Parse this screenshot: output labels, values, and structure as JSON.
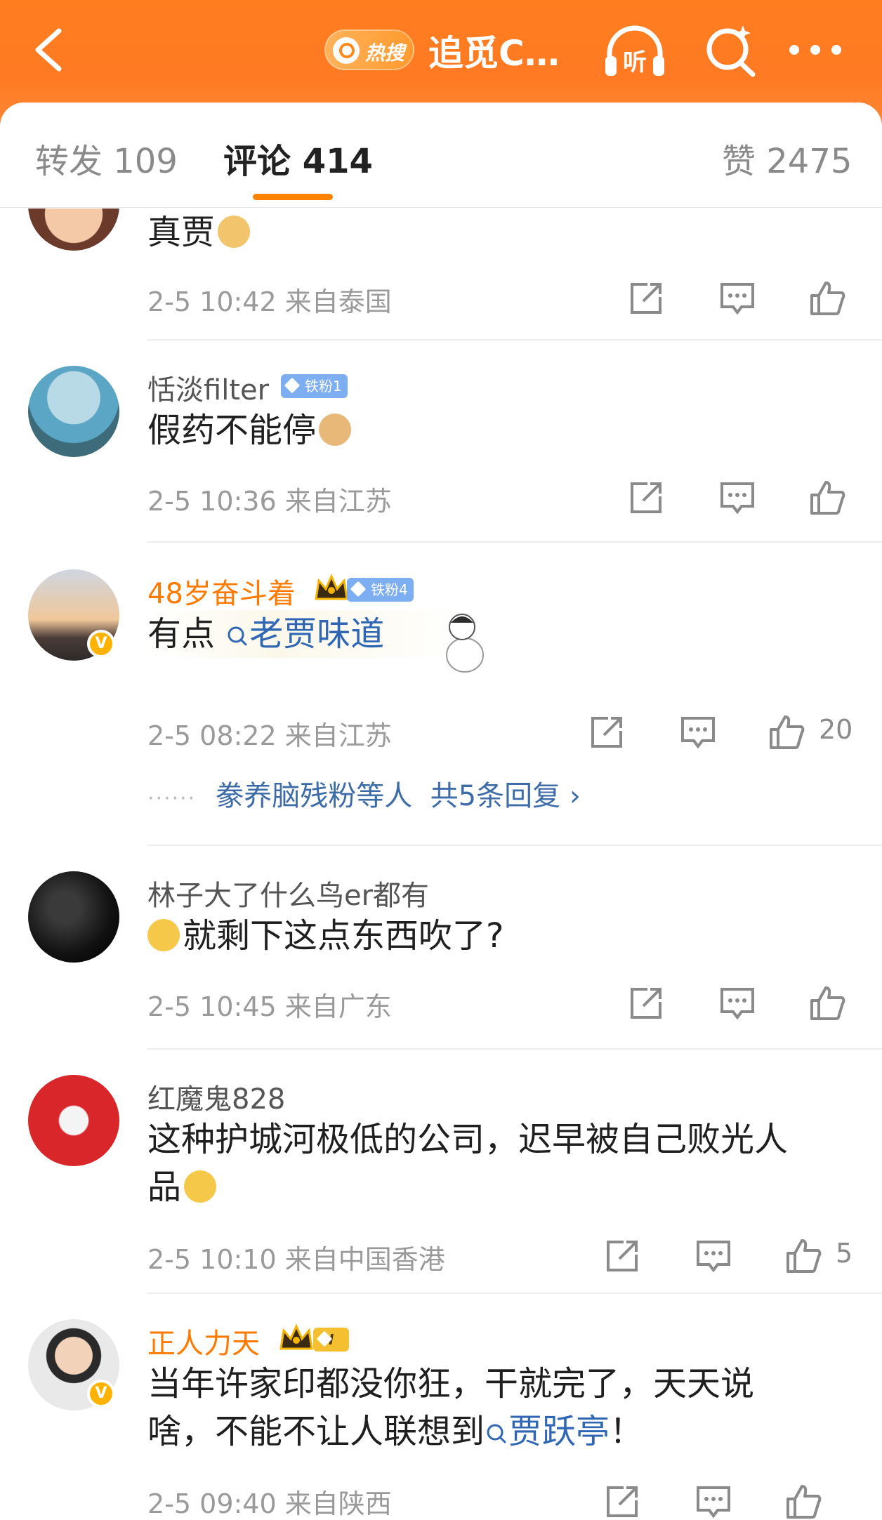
{
  "header": {
    "hot_label": "热搜",
    "title": "追觅C…",
    "listen_label": "听"
  },
  "tabs": [
    {
      "label": "转发 109"
    },
    {
      "label": "评论 414"
    },
    {
      "label": "赞 2475"
    }
  ],
  "colors": {
    "brand": "#ff8200",
    "topic": "#2f67b5",
    "vip_name": "#ff7a00",
    "fan_badge": "#7eaef2"
  },
  "comments": [
    {
      "user": "",
      "text": "真贾",
      "time": "2-5 10:42",
      "source": "来自泰国",
      "likes": ""
    },
    {
      "user": "恬淡filter",
      "badge": "铁粉1",
      "text": "假药不能停",
      "time": "2-5 10:36",
      "source": "来自江苏",
      "likes": ""
    },
    {
      "user": "48岁奋斗着",
      "badge": "铁粉4",
      "text_prefix": "有点",
      "topic": "老贾味道",
      "time": "2-5 08:22",
      "source": "来自江苏",
      "likes": "20",
      "replies_user": "豢养脑残粉等人",
      "replies_count": "共5条回复 ›"
    },
    {
      "user": "林子大了什么鸟er都有",
      "text": "就剩下这点东西吹了?",
      "time": "2-5 10:45",
      "source": "来自广东",
      "likes": ""
    },
    {
      "user": "红魔鬼828",
      "text_line1": "这种护城河极低的公司，迟早被自己败光人",
      "text_line2": "品",
      "time": "2-5 10:10",
      "source": "来自中国香港",
      "likes": "5"
    },
    {
      "user": "正人力天",
      "badge": "I",
      "text_line1": "当年许家印都没你狂，干就完了，天天说",
      "text_line2_prefix": "啥，不能不让人联想到",
      "topic": "贾跃亭",
      "text_line2_suffix": "！",
      "time": "2-5 09:40",
      "source": "来自陕西",
      "likes": ""
    }
  ]
}
